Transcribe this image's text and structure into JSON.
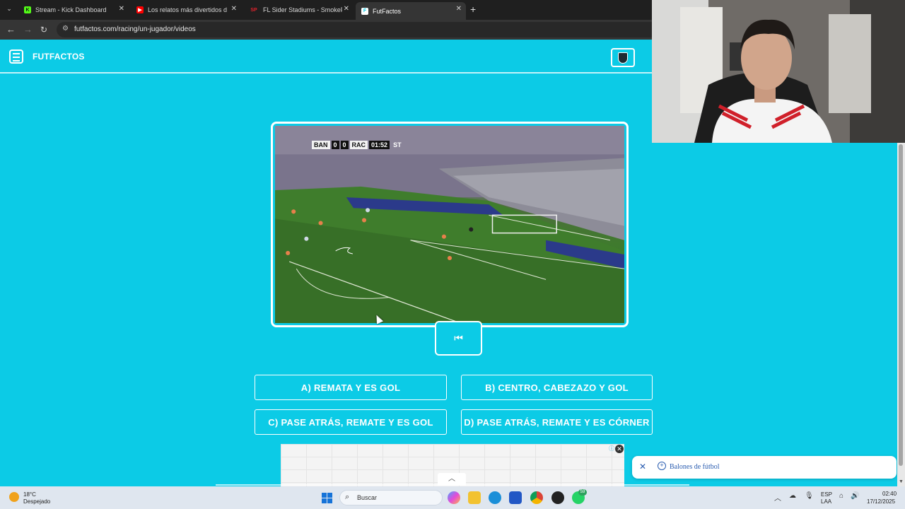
{
  "browser": {
    "tabs": [
      {
        "title": "Stream - Kick Dashboard",
        "favicon_color": "#53fc18",
        "favicon_glyph": "K"
      },
      {
        "title": "Los relatos más divertidos de M",
        "favicon_color": "#ff0000",
        "favicon_glyph": "▶"
      },
      {
        "title": "FL Sider Stadiums - SmokePatc",
        "favicon_color": "#c0121c",
        "favicon_glyph": "SP"
      },
      {
        "title": "FutFactos",
        "favicon_color": "#ffffff",
        "favicon_glyph": "F"
      }
    ],
    "active_tab_index": 3,
    "url": "futfactos.com/racing/un-jugador/videos"
  },
  "site": {
    "logo_text": "FUTFACTOS",
    "accent": "#0ccbe6"
  },
  "video": {
    "scoreboard": {
      "home": "BAN",
      "home_score": "0",
      "away_score": "0",
      "away": "RAC",
      "clock": "01:52",
      "period": "ST"
    }
  },
  "answers": [
    {
      "text": "A) REMATA Y ES GOL"
    },
    {
      "text": "B) CENTRO, CABEZAZO Y GOL"
    },
    {
      "text": "C) PASE ATRÁS, REMATE Y ES GOL"
    },
    {
      "text": "D) PASE ATRÁS, REMATE Y ES CÓRNER"
    }
  ],
  "suggestion": {
    "text": "Balones de fútbol"
  },
  "taskbar": {
    "weather_temp": "18°C",
    "weather_desc": "Despejado",
    "search_placeholder": "Buscar",
    "whatsapp_badge": "59",
    "lang_top": "ESP",
    "lang_bottom": "LAA",
    "time": "02:40",
    "date": "17/12/2025"
  }
}
